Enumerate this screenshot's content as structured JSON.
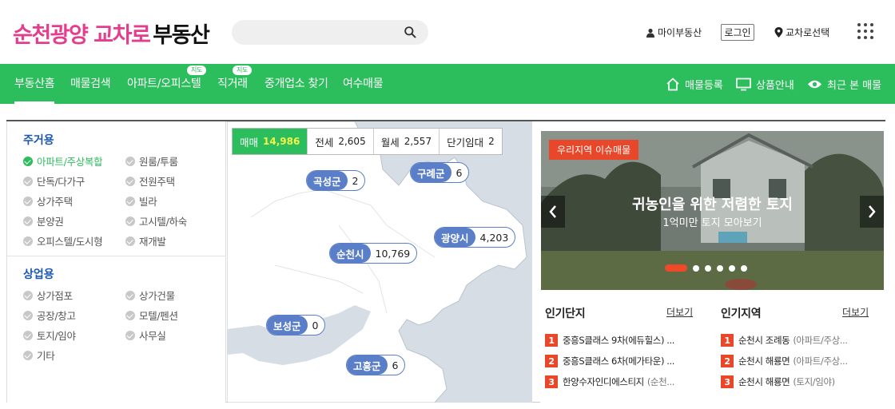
{
  "header": {
    "logo_main": "순천광양 교차로",
    "logo_sub": "부동산",
    "search_placeholder": "",
    "my_estate": "마이부동산",
    "login": "로그인",
    "region_select": "교차로선택"
  },
  "nav": {
    "items": [
      {
        "label": "부동산홈",
        "badge": ""
      },
      {
        "label": "매물검색",
        "badge": ""
      },
      {
        "label": "아파트/오피스텔",
        "badge": "지도"
      },
      {
        "label": "직거래",
        "badge": "지도"
      },
      {
        "label": "중개업소 찾기",
        "badge": ""
      },
      {
        "label": "여수매물",
        "badge": ""
      }
    ],
    "right": [
      "매물등록",
      "상품안내",
      "최근 본 매물"
    ]
  },
  "filters": {
    "residential_title": "주거용",
    "residential": [
      "아파트/주상복합",
      "원룸/투룸",
      "단독/다가구",
      "전원주택",
      "상가주택",
      "빌라",
      "분양권",
      "고시텔/하숙",
      "오피스텔/도시형",
      "재개발"
    ],
    "commercial_title": "상업용",
    "commercial": [
      "상가점포",
      "상가건물",
      "공장/창고",
      "모텔/펜션",
      "토지/임야",
      "사무실",
      "기타"
    ]
  },
  "map": {
    "tabs": [
      {
        "label": "매매",
        "count": "14,986"
      },
      {
        "label": "전세",
        "count": "2,605"
      },
      {
        "label": "월세",
        "count": "2,557"
      },
      {
        "label": "단기임대",
        "count": "2"
      }
    ],
    "regions": [
      {
        "name": "곡성군",
        "count": "2"
      },
      {
        "name": "구례군",
        "count": "6"
      },
      {
        "name": "광양시",
        "count": "4,203"
      },
      {
        "name": "순천시",
        "count": "10,769"
      },
      {
        "name": "보성군",
        "count": "0"
      },
      {
        "name": "고흥군",
        "count": "6"
      }
    ]
  },
  "banner": {
    "tag": "우리지역 이슈매물",
    "title": "귀농인을 위한 저렴한 토지",
    "subtitle": "1억미만 토지 모아보기"
  },
  "popular_complex": {
    "title": "인기단지",
    "more": "더보기",
    "rows": [
      {
        "no": "1",
        "name": "중흥S클래스 9차(에듀힐스) ...",
        "sub": ""
      },
      {
        "no": "2",
        "name": "중흥S클래스 6차(메가타운) ...",
        "sub": ""
      },
      {
        "no": "3",
        "name": "한양수자인디에스티지",
        "sub": "(순천..."
      }
    ]
  },
  "popular_area": {
    "title": "인기지역",
    "more": "더보기",
    "rows": [
      {
        "no": "1",
        "name": "순천시 조례동",
        "sub": "(아파트/주상..."
      },
      {
        "no": "2",
        "name": "순천시 해룡면",
        "sub": "(아파트/주상..."
      },
      {
        "no": "3",
        "name": "순천시 해룡면",
        "sub": "(토지/임야)"
      }
    ]
  },
  "colors": {
    "brand_green": "#2cbd5c",
    "logo_pink": "#e43d8e",
    "accent_red": "#e8472a",
    "pin_blue": "#5a7fc8"
  }
}
